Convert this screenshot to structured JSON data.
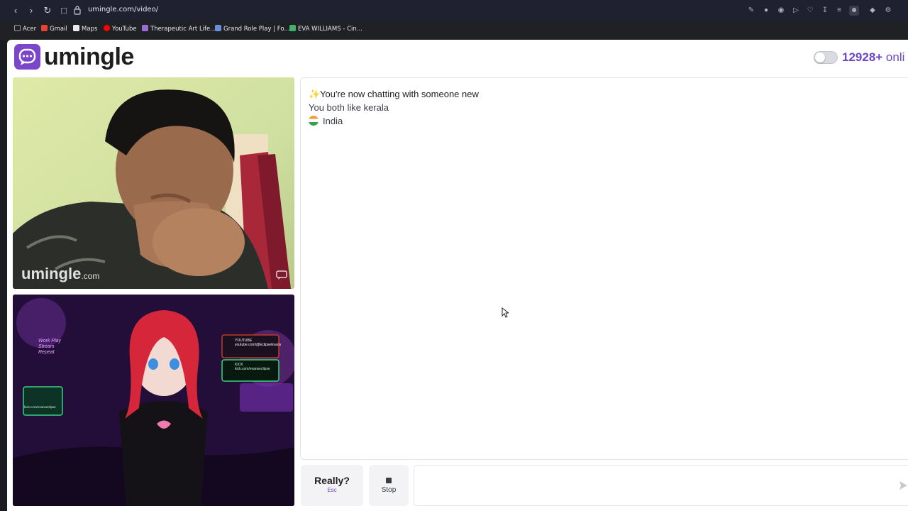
{
  "browser": {
    "url": "umingle.com/video/",
    "bookmarks": [
      {
        "label": "Acer",
        "color": "#9aa0a6"
      },
      {
        "label": "Gmail",
        "color": "#ea4335"
      },
      {
        "label": "Maps",
        "color": "#e8eaed"
      },
      {
        "label": "YouTube",
        "color": "#ff0000"
      },
      {
        "label": "Therapeutic Art Life...",
        "color": "#9b6bd6"
      },
      {
        "label": "Grand Role Play | Fo...",
        "color": "#6a8fd8"
      },
      {
        "label": "EVA WILLIAMS - Cin...",
        "color": "#3fb26b"
      }
    ]
  },
  "header": {
    "logo": "umingle",
    "online_count": "12928+",
    "online_suffix": " onli"
  },
  "videos": {
    "remote_watermark": "umingle",
    "remote_watermark_suffix": ".com",
    "local_overlay": {
      "work_sign": "Work Play Stream Repeat",
      "youtube_title": "YOUTUBE",
      "youtube_handle": "youtube.com/@EclipseEvans",
      "kick_title": "KICK",
      "kick_handle": "kick.com/evanseclipse",
      "twitch_handle": "kick.com/evanseclipse"
    }
  },
  "chat": {
    "title": "You're now chatting with someone new",
    "likes": "You both like kerala",
    "country": "India"
  },
  "controls": {
    "really_label": "Really?",
    "really_hint": "Esc",
    "stop_label": "Stop",
    "input_placeholder": ""
  },
  "colors": {
    "brand": "#7b46c9",
    "online": "#6c46c7"
  }
}
